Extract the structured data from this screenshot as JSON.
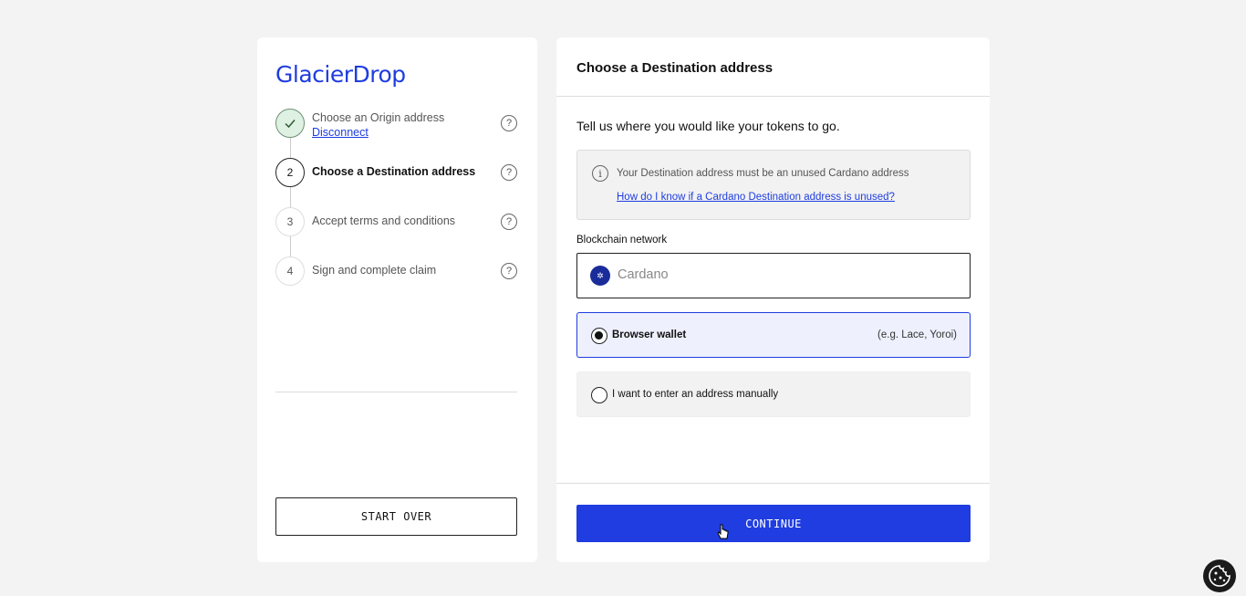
{
  "brand": {
    "logo_text": "GlacierDrop",
    "accent": "#1f3de0"
  },
  "steps": [
    {
      "number": "",
      "label": "Choose an Origin address",
      "sublink": "Disconnect",
      "status": "done",
      "help": "?"
    },
    {
      "number": "2",
      "label": "Choose a Destination address",
      "status": "active",
      "help": "?"
    },
    {
      "number": "3",
      "label": "Accept terms and conditions",
      "status": "pending",
      "help": "?"
    },
    {
      "number": "4",
      "label": "Sign and complete claim",
      "status": "pending",
      "help": "?"
    }
  ],
  "left": {
    "start_over_label": "START OVER"
  },
  "main": {
    "title": "Choose a Destination address",
    "intro": "Tell us where you would like your tokens to go.",
    "info": {
      "text": "Your Destination address must be an unused Cardano address",
      "link": "How do I know if a Cardano Destination address is unused?"
    },
    "network": {
      "label": "Blockchain network",
      "value": "Cardano"
    },
    "options": [
      {
        "label": "Browser wallet",
        "hint": "(e.g. Lace, Yoroi)",
        "selected": true
      },
      {
        "label": "I want to enter an address manually",
        "hint": "",
        "selected": false
      }
    ],
    "continue_label": "CONTINUE"
  }
}
